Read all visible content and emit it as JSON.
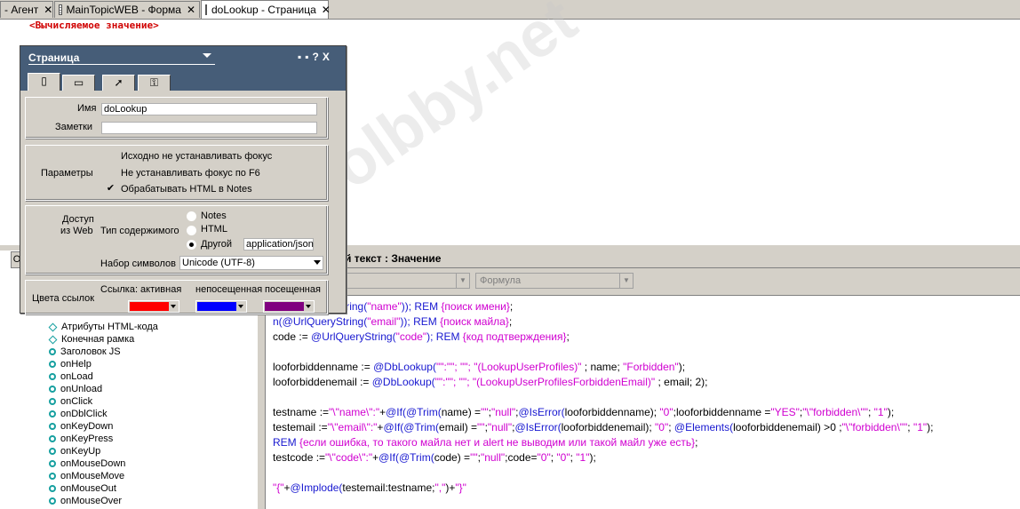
{
  "tabs": [
    {
      "label": "- Агент",
      "icon": "none"
    },
    {
      "label": "MainTopicWEB - Форма",
      "icon": "form-icon"
    },
    {
      "label": "doLookup - Страница",
      "icon": "page-icon"
    }
  ],
  "top_editor": {
    "computed_text": "<Вычисляемое значение>"
  },
  "dialog": {
    "title": "Страница",
    "controls": {
      "menu": "▪▪",
      "help": "?",
      "close": "X"
    },
    "tabs": [
      "page-icon",
      "background-icon",
      "launch-icon",
      "key-icon"
    ],
    "name_label": "Имя",
    "name_value": "doLookup",
    "comment_label": "Заметки",
    "comment_value": "",
    "params_label": "Параметры",
    "params": [
      {
        "label": "Исходно не устанавливать фокус",
        "checked": false
      },
      {
        "label": "Не устанавливать фокус по F6",
        "checked": false
      },
      {
        "label": "Обрабатывать HTML в Notes",
        "checked": true
      }
    ],
    "web_label_1": "Доступ",
    "web_label_2": "из Web",
    "content_type_label": "Тип содержимого",
    "content_types": [
      {
        "label": "Notes",
        "selected": false
      },
      {
        "label": "HTML",
        "selected": false
      },
      {
        "label": "Другой",
        "selected": true
      }
    ],
    "other_value": "application/json",
    "charset_label": "Набор символов",
    "charset_value": "Unicode (UTF-8)",
    "colors_label": "Цвета ссылок",
    "link_active_label": "Ссылка: активная",
    "link_unvisited_label": "непосещенная",
    "link_visited_label": "посещенная",
    "colors": {
      "active": "#ff0000",
      "unvisited": "#0000ff",
      "visited": "#800080"
    }
  },
  "objects": {
    "tab_label": "О",
    "items": [
      {
        "label": "Атрибуты HTML-кода",
        "icon": "diamond-icon"
      },
      {
        "label": "Конечная рамка",
        "icon": "diamond-icon"
      },
      {
        "label": "Заголовок JS",
        "icon": "event-icon"
      },
      {
        "label": "onHelp",
        "icon": "event-icon"
      },
      {
        "label": "onLoad",
        "icon": "event-icon"
      },
      {
        "label": "onUnload",
        "icon": "event-icon"
      },
      {
        "label": "onClick",
        "icon": "event-icon"
      },
      {
        "label": "onDblClick",
        "icon": "event-icon"
      },
      {
        "label": "onKeyDown",
        "icon": "event-icon"
      },
      {
        "label": "onKeyPress",
        "icon": "event-icon"
      },
      {
        "label": "onKeyUp",
        "icon": "event-icon"
      },
      {
        "label": "onMouseDown",
        "icon": "event-icon"
      },
      {
        "label": "onMouseMove",
        "icon": "event-icon"
      },
      {
        "label": "onMouseOut",
        "icon": "event-icon"
      },
      {
        "label": "onMouseOver",
        "icon": "event-icon"
      }
    ]
  },
  "code_pane": {
    "header": "й текст : Значение",
    "dropdown1": "",
    "dropdown2": "Формула",
    "lines": [
      [
        {
          "t": "n(@UrlQueryString(",
          "c": "f"
        },
        {
          "t": "\"name\"",
          "c": "s"
        },
        {
          "t": ")); REM ",
          "c": "f"
        },
        {
          "t": "{поиск имени}",
          "c": "s"
        },
        {
          "t": ";",
          "c": "p"
        }
      ],
      [
        {
          "t": "n(@UrlQueryString(",
          "c": "f"
        },
        {
          "t": "\"email\"",
          "c": "s"
        },
        {
          "t": ")); REM ",
          "c": "f"
        },
        {
          "t": "{поиск майла}",
          "c": "s"
        },
        {
          "t": ";",
          "c": "p"
        }
      ],
      [
        {
          "t": "code := ",
          "c": "p"
        },
        {
          "t": "@UrlQueryString(",
          "c": "f"
        },
        {
          "t": "\"code\"",
          "c": "s"
        },
        {
          "t": "); REM ",
          "c": "f"
        },
        {
          "t": "{код подтверждения}",
          "c": "s"
        },
        {
          "t": ";",
          "c": "p"
        }
      ],
      [],
      [
        {
          "t": "looforbiddenname := ",
          "c": "p"
        },
        {
          "t": "@DbLookup(",
          "c": "f"
        },
        {
          "t": "\"\":\"\"; \"\"; \"(LookupUserProfiles)\"",
          "c": "s"
        },
        {
          "t": " ; name; ",
          "c": "p"
        },
        {
          "t": "\"Forbidden\"",
          "c": "s"
        },
        {
          "t": ");",
          "c": "p"
        }
      ],
      [
        {
          "t": "looforbiddenemail := ",
          "c": "p"
        },
        {
          "t": "@DbLookup(",
          "c": "f"
        },
        {
          "t": "\"\":\"\"; \"\"; \"(LookupUserProfilesForbiddenEmail)\"",
          "c": "s"
        },
        {
          "t": " ; email; 2);",
          "c": "p"
        }
      ],
      [],
      [
        {
          "t": "testname :=",
          "c": "p"
        },
        {
          "t": "\"\\\"name\\\":\"",
          "c": "s"
        },
        {
          "t": "+",
          "c": "p"
        },
        {
          "t": "@If(@Trim(",
          "c": "f"
        },
        {
          "t": "name) =",
          "c": "p"
        },
        {
          "t": "\"\"",
          "c": "s"
        },
        {
          "t": ";",
          "c": "p"
        },
        {
          "t": "\"null\"",
          "c": "s"
        },
        {
          "t": ";",
          "c": "p"
        },
        {
          "t": "@IsError(",
          "c": "f"
        },
        {
          "t": "looforbiddenname); ",
          "c": "p"
        },
        {
          "t": "\"0\"",
          "c": "s"
        },
        {
          "t": ";looforbiddenname =",
          "c": "p"
        },
        {
          "t": "\"YES\"",
          "c": "s"
        },
        {
          "t": ";",
          "c": "p"
        },
        {
          "t": "\"\\\"forbidden\\\"\"",
          "c": "s"
        },
        {
          "t": "; ",
          "c": "p"
        },
        {
          "t": "\"1\"",
          "c": "s"
        },
        {
          "t": ");",
          "c": "p"
        }
      ],
      [
        {
          "t": "testemail :=",
          "c": "p"
        },
        {
          "t": "\"\\\"email\\\":\"",
          "c": "s"
        },
        {
          "t": "+",
          "c": "p"
        },
        {
          "t": "@If(@Trim(",
          "c": "f"
        },
        {
          "t": "email) =",
          "c": "p"
        },
        {
          "t": "\"\"",
          "c": "s"
        },
        {
          "t": ";",
          "c": "p"
        },
        {
          "t": "\"null\"",
          "c": "s"
        },
        {
          "t": ";",
          "c": "p"
        },
        {
          "t": "@IsError(",
          "c": "f"
        },
        {
          "t": "looforbiddenemail); ",
          "c": "p"
        },
        {
          "t": "\"0\"",
          "c": "s"
        },
        {
          "t": "; ",
          "c": "p"
        },
        {
          "t": "@Elements(",
          "c": "f"
        },
        {
          "t": "looforbiddenemail) >0 ;",
          "c": "p"
        },
        {
          "t": "\"\\\"forbidden\\\"\"",
          "c": "s"
        },
        {
          "t": "; ",
          "c": "p"
        },
        {
          "t": "\"1\"",
          "c": "s"
        },
        {
          "t": ");",
          "c": "p"
        }
      ],
      [
        {
          "t": "REM ",
          "c": "f"
        },
        {
          "t": "{если ошибка, то такого майла нет и alert не выводим или такой майл уже есть}",
          "c": "s"
        },
        {
          "t": ";",
          "c": "p"
        }
      ],
      [
        {
          "t": "testcode :=",
          "c": "p"
        },
        {
          "t": "\"\\\"code\\\":\"",
          "c": "s"
        },
        {
          "t": "+",
          "c": "p"
        },
        {
          "t": "@If(@Trim(",
          "c": "f"
        },
        {
          "t": "code) =",
          "c": "p"
        },
        {
          "t": "\"\"",
          "c": "s"
        },
        {
          "t": ";",
          "c": "p"
        },
        {
          "t": "\"null\"",
          "c": "s"
        },
        {
          "t": ";code=",
          "c": "p"
        },
        {
          "t": "\"0\"",
          "c": "s"
        },
        {
          "t": "; ",
          "c": "p"
        },
        {
          "t": "\"0\"",
          "c": "s"
        },
        {
          "t": "; ",
          "c": "p"
        },
        {
          "t": "\"1\"",
          "c": "s"
        },
        {
          "t": ");",
          "c": "p"
        }
      ],
      [],
      [
        {
          "t": "\"{\"",
          "c": "s"
        },
        {
          "t": "+",
          "c": "p"
        },
        {
          "t": "@Implode(",
          "c": "f"
        },
        {
          "t": "testemail:testname;",
          "c": "p"
        },
        {
          "t": "\",\"",
          "c": "s"
        },
        {
          "t": ")+",
          "c": "p"
        },
        {
          "t": "\"}\"",
          "c": "s"
        }
      ]
    ]
  },
  "watermark": "coolbby.net"
}
